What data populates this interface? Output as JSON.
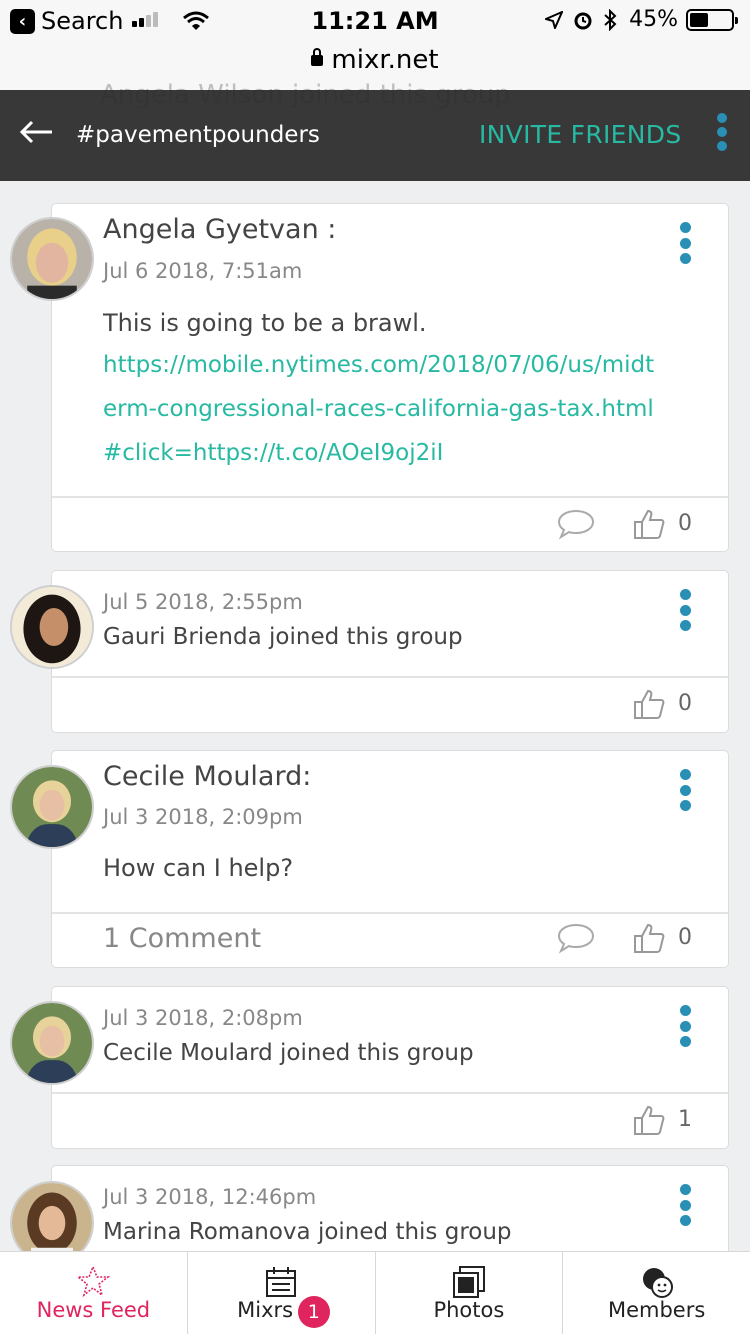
{
  "status_bar": {
    "back_app": "Search",
    "time": "11:21 AM",
    "battery": "45%",
    "battery_level": 0.45,
    "signal_bars_on": 2,
    "signal_bars_total": 5,
    "icons": [
      "location-icon",
      "alarm-icon",
      "bluetooth-icon"
    ]
  },
  "browser": {
    "url": "mixr.net"
  },
  "header": {
    "back_icon": "back-arrow-icon",
    "title": "#pavementpounders",
    "invite_label": "INVITE FRIENDS",
    "menu_icon": "more-vertical-icon",
    "accent_color": "#27b9a2"
  },
  "scrolled_peek": {
    "text": "Angela Wilson joined this group"
  },
  "feed": [
    {
      "type": "post",
      "author": "Angela Gyetvan :",
      "date": "Jul 6 2018, 7:51am",
      "text": "This is going to be a brawl.",
      "link": "https://mobile.nytimes.com/2018/07/06/us/midterm-congressional-races-california-gas-tax.html#click=https://t.co/AOeI9oj2iI",
      "likes": "0"
    },
    {
      "type": "join",
      "date": "Jul 5 2018, 2:55pm",
      "activity": "Gauri Brienda joined this group",
      "likes": "0"
    },
    {
      "type": "post",
      "author": "Cecile Moulard:",
      "date": "Jul 3 2018, 2:09pm",
      "text": "How can I help?",
      "comments": "1 Comment",
      "likes": "0"
    },
    {
      "type": "join",
      "date": "Jul 3 2018, 2:08pm",
      "activity": "Cecile Moulard joined this group",
      "likes": "1"
    },
    {
      "type": "join",
      "date": "Jul 3 2018, 12:46pm",
      "activity": "Marina Romanova joined this group"
    }
  ],
  "tabs": [
    {
      "label": "News Feed",
      "icon": "star-icon",
      "active": true
    },
    {
      "label": "Mixrs",
      "icon": "calendar-icon",
      "badge": "1"
    },
    {
      "label": "Photos",
      "icon": "photos-icon"
    },
    {
      "label": "Members",
      "icon": "members-icon"
    }
  ],
  "colors": {
    "link": "#27b9a2",
    "menu_dots": "#2a8fb5",
    "active_tab": "#e0245e",
    "badge": "#e0245e"
  }
}
